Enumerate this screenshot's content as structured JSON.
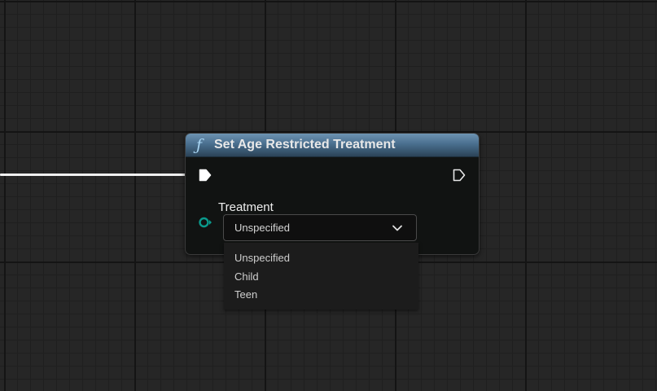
{
  "node": {
    "icon": "function-icon",
    "icon_glyph": "ƒ",
    "title": "Set Age Restricted Treatment",
    "header_color": "#4a6f8f",
    "param": {
      "label": "Treatment",
      "pin_color": "#0a9a8c"
    }
  },
  "combo": {
    "selected": "Unspecified",
    "options": [
      "Unspecified",
      "Child",
      "Teen"
    ]
  },
  "colors": {
    "canvas_bg": "#262626",
    "node_body": "#111312",
    "wire": "#f0f0f0",
    "enum_pin": "#0a9a8c"
  }
}
